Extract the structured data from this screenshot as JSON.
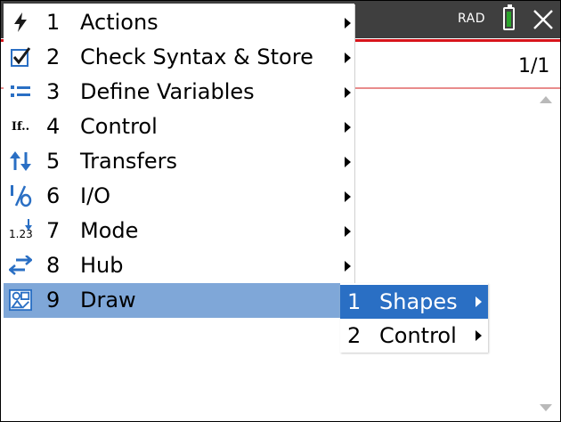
{
  "status": {
    "angle_mode": "RAD",
    "page_indicator": "1/1"
  },
  "menu": {
    "items": [
      {
        "num": "1",
        "label": "Actions",
        "icon": "lightning-icon"
      },
      {
        "num": "2",
        "label": "Check Syntax & Store",
        "icon": "checkbox-icon"
      },
      {
        "num": "3",
        "label": "Define Variables",
        "icon": "define-variables-icon"
      },
      {
        "num": "4",
        "label": "Control",
        "icon": "control-if-icon",
        "icon_text": "If.."
      },
      {
        "num": "5",
        "label": "Transfers",
        "icon": "transfer-arrows-icon"
      },
      {
        "num": "6",
        "label": "I/O",
        "icon": "io-icon"
      },
      {
        "num": "7",
        "label": "Mode",
        "icon": "mode-icon",
        "icon_text": "1.23"
      },
      {
        "num": "8",
        "label": "Hub",
        "icon": "hub-arrows-icon"
      },
      {
        "num": "9",
        "label": "Draw",
        "icon": "draw-shapes-icon"
      }
    ],
    "selected_index": 8
  },
  "submenu": {
    "items": [
      {
        "num": "1",
        "label": "Shapes"
      },
      {
        "num": "2",
        "label": "Control"
      }
    ],
    "selected_index": 0
  },
  "colors": {
    "titlebar": "#3f3f3f",
    "accent_red": "#d8141b",
    "selection_light": "#7fa7d8",
    "selection_dark": "#2a6fc4",
    "battery": "#2aa52a"
  }
}
